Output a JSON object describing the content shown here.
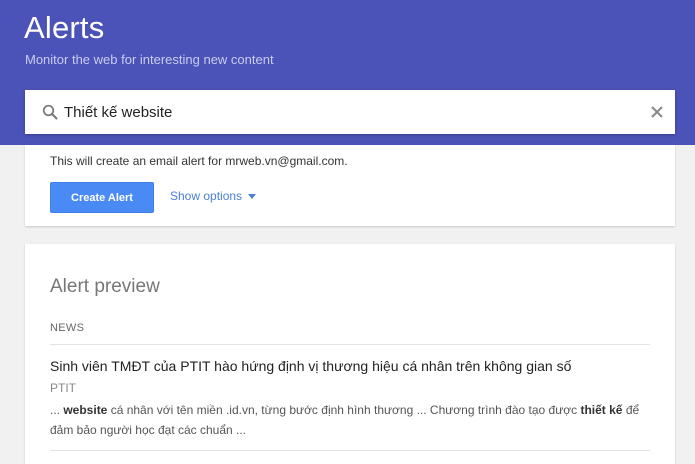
{
  "header": {
    "title": "Alerts",
    "subtitle": "Monitor the web for interesting new content",
    "background_color": "#4c53b8"
  },
  "search": {
    "value": "Thiết kế website",
    "icon": "search-icon",
    "clear_icon": "close-icon"
  },
  "create_card": {
    "email_note": "This will create an email alert for mrweb.vn@gmail.com.",
    "create_button_label": "Create Alert",
    "show_options_label": "Show options",
    "accent_color": "#4a8af4"
  },
  "preview": {
    "title": "Alert preview",
    "section_label": "NEWS",
    "articles": [
      {
        "title": "Sinh viên TMĐT của PTIT hào hứng định vị thương hiệu cá nhân trên không gian số",
        "source": "PTIT",
        "snippet_parts": [
          {
            "text": "... ",
            "bold": false
          },
          {
            "text": "website",
            "bold": true
          },
          {
            "text": " cá nhân với tên miền .id.vn, từng bước định hình thương ... Chương trình đào tạo được ",
            "bold": false
          },
          {
            "text": "thiết kế",
            "bold": true
          },
          {
            "text": " để đảm bảo người học đạt các chuẩn ...",
            "bold": false
          }
        ]
      }
    ]
  }
}
